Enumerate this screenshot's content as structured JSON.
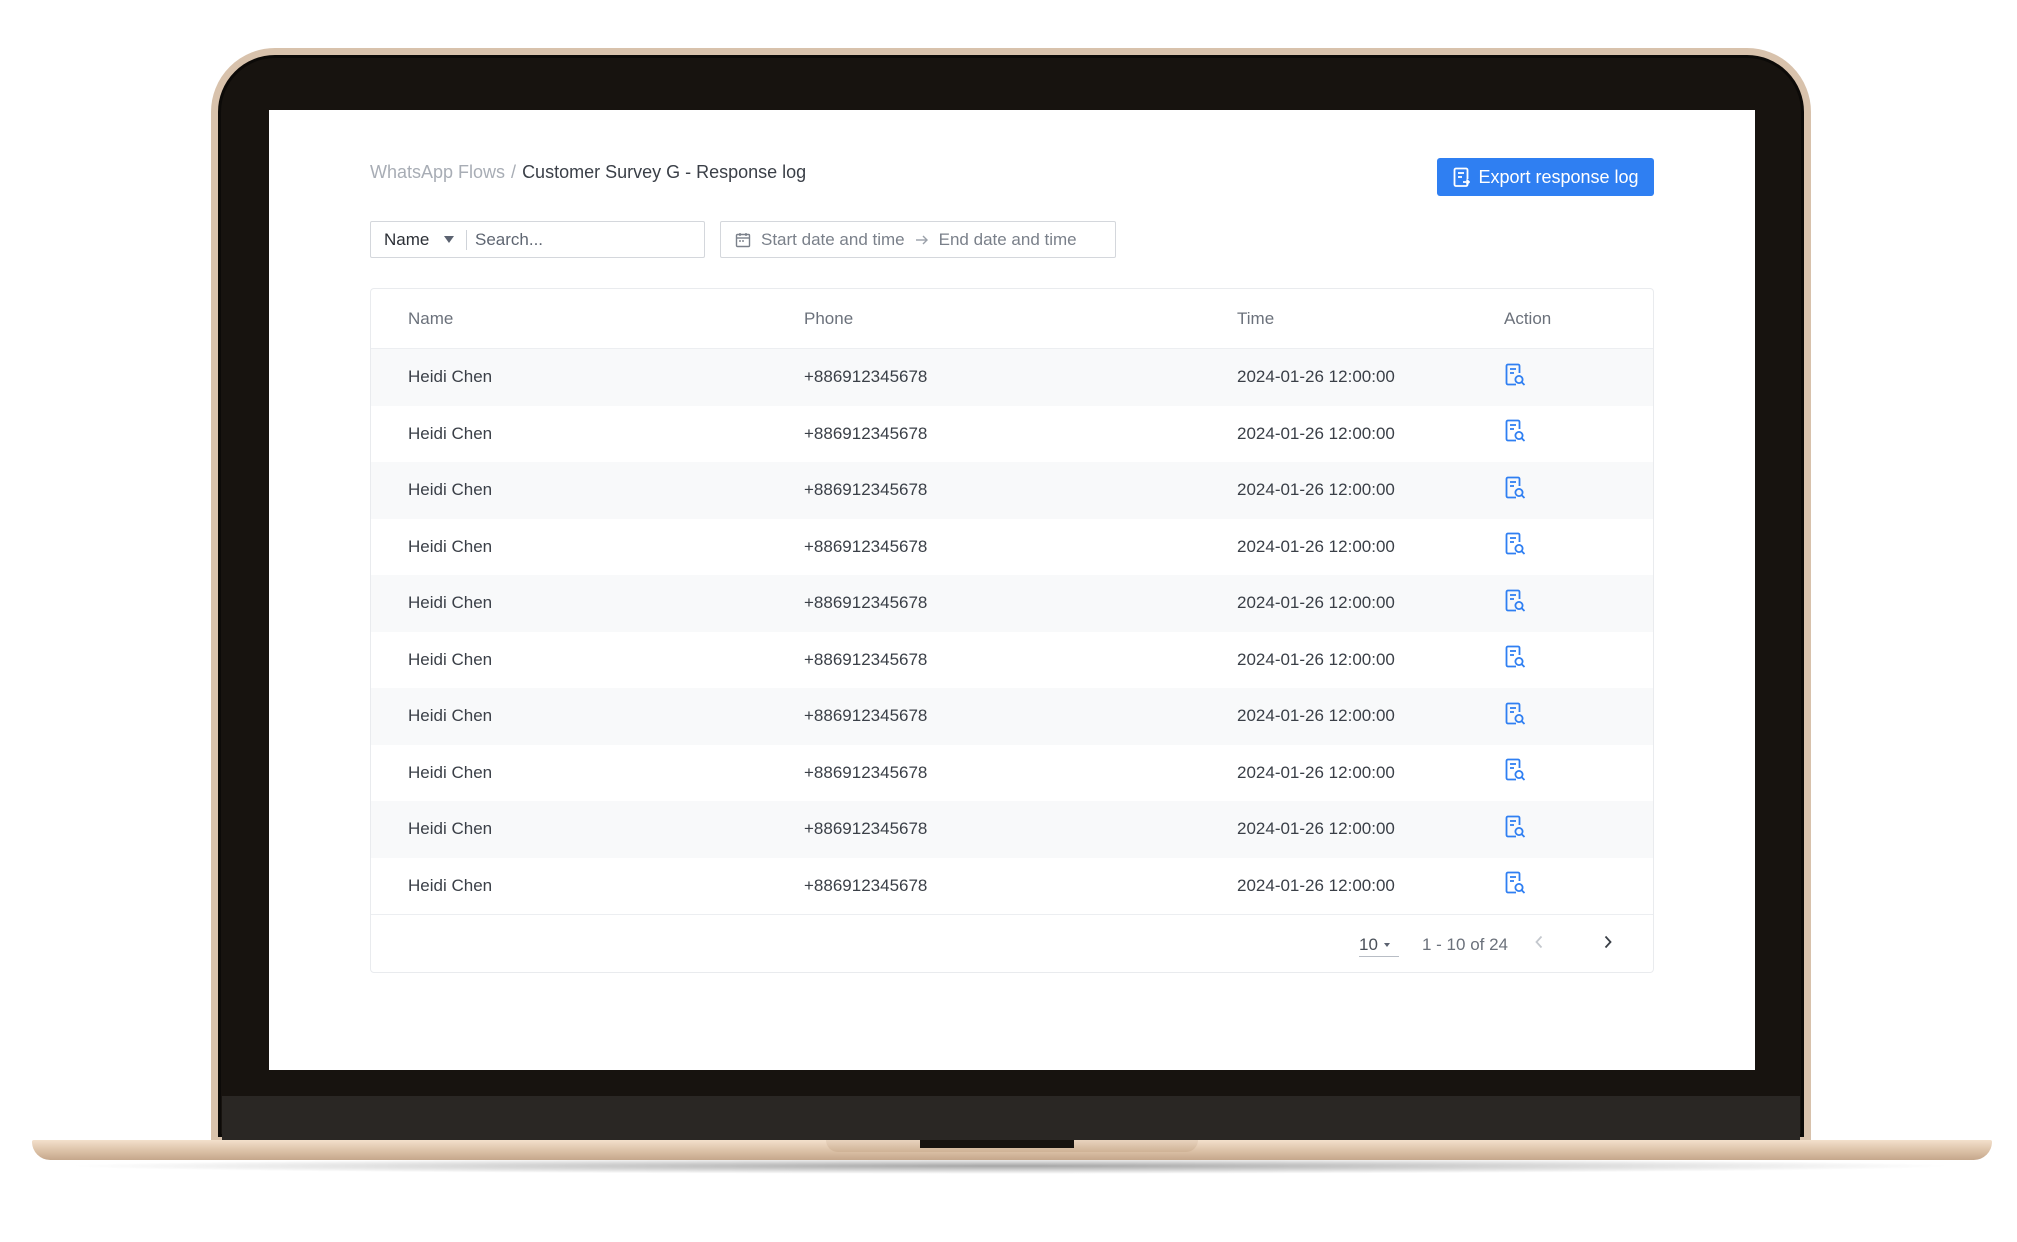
{
  "breadcrumb": {
    "parent": "WhatsApp Flows",
    "separator": "/",
    "current": "Customer Survey G - Response log"
  },
  "export_button": {
    "label": "Export response log",
    "icon": "export-document-icon"
  },
  "filters": {
    "field_select_value": "Name",
    "search_placeholder": "Search...",
    "date_start_placeholder": "Start date and time",
    "date_end_placeholder": "End date and time"
  },
  "table": {
    "columns": [
      "Name",
      "Phone",
      "Time",
      "Action"
    ],
    "rows": [
      {
        "name": "Heidi Chen",
        "phone": "+886912345678",
        "time": "2024-01-26 12:00:00",
        "action_icon": "view-document-icon"
      },
      {
        "name": "Heidi Chen",
        "phone": "+886912345678",
        "time": "2024-01-26 12:00:00",
        "action_icon": "view-document-icon"
      },
      {
        "name": "Heidi Chen",
        "phone": "+886912345678",
        "time": "2024-01-26 12:00:00",
        "action_icon": "view-document-icon"
      },
      {
        "name": "Heidi Chen",
        "phone": "+886912345678",
        "time": "2024-01-26 12:00:00",
        "action_icon": "view-document-icon"
      },
      {
        "name": "Heidi Chen",
        "phone": "+886912345678",
        "time": "2024-01-26 12:00:00",
        "action_icon": "view-document-icon"
      },
      {
        "name": "Heidi Chen",
        "phone": "+886912345678",
        "time": "2024-01-26 12:00:00",
        "action_icon": "view-document-icon"
      },
      {
        "name": "Heidi Chen",
        "phone": "+886912345678",
        "time": "2024-01-26 12:00:00",
        "action_icon": "view-document-icon"
      },
      {
        "name": "Heidi Chen",
        "phone": "+886912345678",
        "time": "2024-01-26 12:00:00",
        "action_icon": "view-document-icon"
      },
      {
        "name": "Heidi Chen",
        "phone": "+886912345678",
        "time": "2024-01-26 12:00:00",
        "action_icon": "view-document-icon"
      },
      {
        "name": "Heidi Chen",
        "phone": "+886912345678",
        "time": "2024-01-26 12:00:00",
        "action_icon": "view-document-icon"
      }
    ]
  },
  "pagination": {
    "page_size": "10",
    "range_text": "1 - 10 of  24"
  },
  "colors": {
    "accent": "#2f7ff2",
    "laptop_gold": "#d8c2ac",
    "bezel": "#17130f"
  }
}
